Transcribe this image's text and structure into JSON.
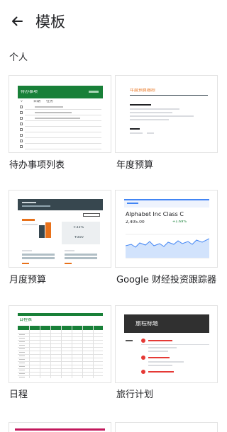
{
  "header": {
    "title": "模板"
  },
  "section": {
    "title": "个人"
  },
  "templates": [
    {
      "name": "待办事项列表",
      "preview": {
        "title": "待办事项",
        "col1": "√",
        "col2": "日期",
        "col3": "任务"
      }
    },
    {
      "name": "年度预算",
      "preview": {
        "title": "年度预算跟踪"
      }
    },
    {
      "name": "月度预算",
      "preview": {
        "badge": "+33%",
        "amount": "¥300"
      }
    },
    {
      "name": "Google 财经投资跟踪器",
      "preview": {
        "company": "Alphabet Inc Class C",
        "price": "2,405.00",
        "change": "+1.69%"
      }
    },
    {
      "name": "日程",
      "preview": {
        "title": "日程表"
      }
    },
    {
      "name": "旅行计划",
      "preview": {
        "title": "旅程标题"
      }
    }
  ],
  "colors": {
    "todo_green": "#188038",
    "accent_red": "#e8711a",
    "dark_navy": "#37474f",
    "finance_blue": "#4285f4",
    "trip_dark": "#303030",
    "peek_magenta": "#c2185b"
  }
}
